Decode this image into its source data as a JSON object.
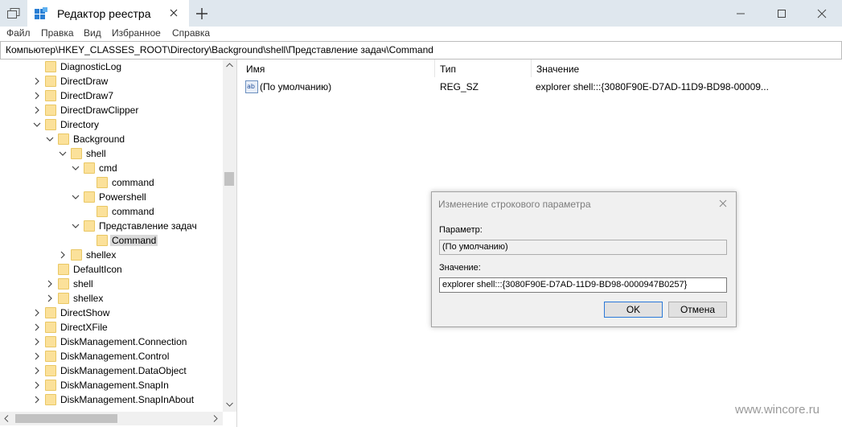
{
  "window": {
    "tab_title": "Редактор реестра",
    "minimize_icon": "minimize-icon",
    "maximize_icon": "maximize-icon",
    "close_icon": "close-icon"
  },
  "menu": [
    "Файл",
    "Правка",
    "Вид",
    "Избранное",
    "Справка"
  ],
  "address": "Компьютер\\HKEY_CLASSES_ROOT\\Directory\\Background\\shell\\Представление задач\\Command",
  "tree": [
    {
      "label": "DiagnosticLog",
      "indent": 0,
      "chevron": "none",
      "selected": false
    },
    {
      "label": "DirectDraw",
      "indent": 0,
      "chevron": "right",
      "selected": false
    },
    {
      "label": "DirectDraw7",
      "indent": 0,
      "chevron": "right",
      "selected": false
    },
    {
      "label": "DirectDrawClipper",
      "indent": 0,
      "chevron": "right",
      "selected": false
    },
    {
      "label": "Directory",
      "indent": 0,
      "chevron": "down",
      "selected": false
    },
    {
      "label": "Background",
      "indent": 1,
      "chevron": "down",
      "selected": false
    },
    {
      "label": "shell",
      "indent": 2,
      "chevron": "down",
      "selected": false
    },
    {
      "label": "cmd",
      "indent": 3,
      "chevron": "down",
      "selected": false
    },
    {
      "label": "command",
      "indent": 4,
      "chevron": "none",
      "selected": false
    },
    {
      "label": "Powershell",
      "indent": 3,
      "chevron": "down",
      "selected": false
    },
    {
      "label": "command",
      "indent": 4,
      "chevron": "none",
      "selected": false
    },
    {
      "label": "Представление задач",
      "indent": 3,
      "chevron": "down",
      "selected": false
    },
    {
      "label": "Command",
      "indent": 4,
      "chevron": "none",
      "selected": true
    },
    {
      "label": "shellex",
      "indent": 2,
      "chevron": "right",
      "selected": false
    },
    {
      "label": "DefaultIcon",
      "indent": 1,
      "chevron": "none",
      "selected": false
    },
    {
      "label": "shell",
      "indent": 1,
      "chevron": "right",
      "selected": false
    },
    {
      "label": "shellex",
      "indent": 1,
      "chevron": "right",
      "selected": false
    },
    {
      "label": "DirectShow",
      "indent": 0,
      "chevron": "right",
      "selected": false
    },
    {
      "label": "DirectXFile",
      "indent": 0,
      "chevron": "right",
      "selected": false
    },
    {
      "label": "DiskManagement.Connection",
      "indent": 0,
      "chevron": "right",
      "selected": false
    },
    {
      "label": "DiskManagement.Control",
      "indent": 0,
      "chevron": "right",
      "selected": false
    },
    {
      "label": "DiskManagement.DataObject",
      "indent": 0,
      "chevron": "right",
      "selected": false
    },
    {
      "label": "DiskManagement.SnapIn",
      "indent": 0,
      "chevron": "right",
      "selected": false
    },
    {
      "label": "DiskManagement.SnapInAbout",
      "indent": 0,
      "chevron": "right",
      "selected": false
    }
  ],
  "list": {
    "columns": [
      "Имя",
      "Тип",
      "Значение"
    ],
    "rows": [
      {
        "name": "(По умолчанию)",
        "type": "REG_SZ",
        "value": "explorer shell:::{3080F90E-D7AD-11D9-BD98-00009...",
        "icon": "string-value-icon"
      }
    ]
  },
  "dialog": {
    "title": "Изменение строкового параметра",
    "param_label": "Параметр:",
    "param_value": "(По умолчанию)",
    "value_label": "Значение:",
    "value": "explorer shell:::{3080F90E-D7AD-11D9-BD98-0000947B0257}",
    "ok": "OK",
    "cancel": "Отмена"
  },
  "watermark": "www.wincore.ru",
  "colors": {
    "titlebar": "#dfe7ee",
    "folder": "#fbe19a",
    "selection": "#d9d9d9",
    "dialog_bg": "#f0f0f0",
    "default_button_border": "#2b79d8"
  }
}
